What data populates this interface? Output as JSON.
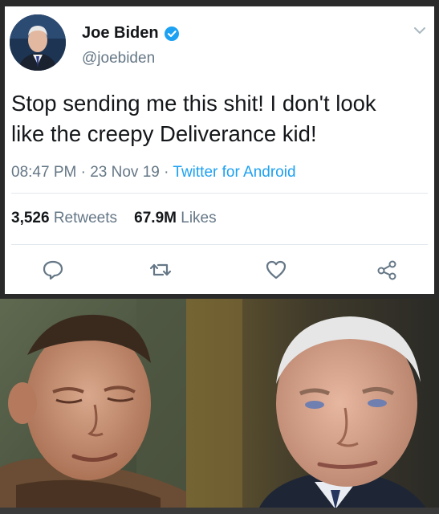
{
  "author": {
    "name": "Joe Biden",
    "handle": "@joebiden",
    "avatar_icon": "person-portrait",
    "verified_icon": "verified-badge-icon"
  },
  "tweet": {
    "text_line1": "Stop sending me this shit! I don't look",
    "text_line2": "like the creepy Deliverance kid!",
    "time": "08:47 PM",
    "sep1": " · ",
    "date": "23 Nov 19",
    "sep2": " · ",
    "source": "Twitter for Android"
  },
  "stats": {
    "retweets_count": "3,526",
    "retweets_label": "Retweets",
    "likes_count": "67.9M",
    "likes_label": "Likes"
  },
  "actions": [
    "reply-icon",
    "retweet-icon",
    "like-icon",
    "share-icon"
  ],
  "colors": {
    "text_primary": "#14171a",
    "text_secondary": "#657786",
    "accent": "#1da1f2"
  }
}
